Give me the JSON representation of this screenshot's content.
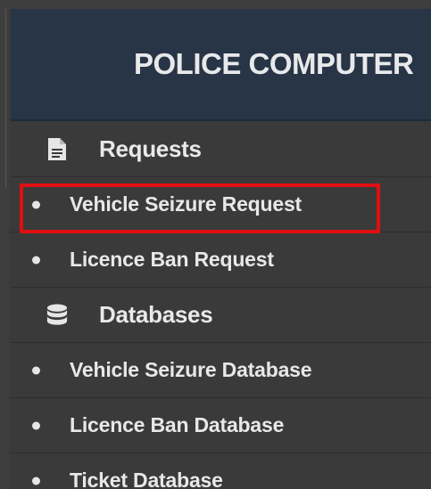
{
  "header": {
    "title": "POLICE COMPUTER"
  },
  "menu": {
    "sections": [
      {
        "label": "Requests",
        "icon": "document-icon",
        "items": [
          {
            "label": "Vehicle Seizure Request"
          },
          {
            "label": "Licence Ban Request"
          }
        ]
      },
      {
        "label": "Databases",
        "icon": "database-icon",
        "items": [
          {
            "label": "Vehicle Seizure Database"
          },
          {
            "label": "Licence Ban Database"
          },
          {
            "label": "Ticket Database"
          }
        ]
      }
    ]
  },
  "colors": {
    "header_bg": "#283546",
    "menu_bg": "#3a3a3a",
    "highlight": "#e01010",
    "text": "#e8e8e8"
  }
}
